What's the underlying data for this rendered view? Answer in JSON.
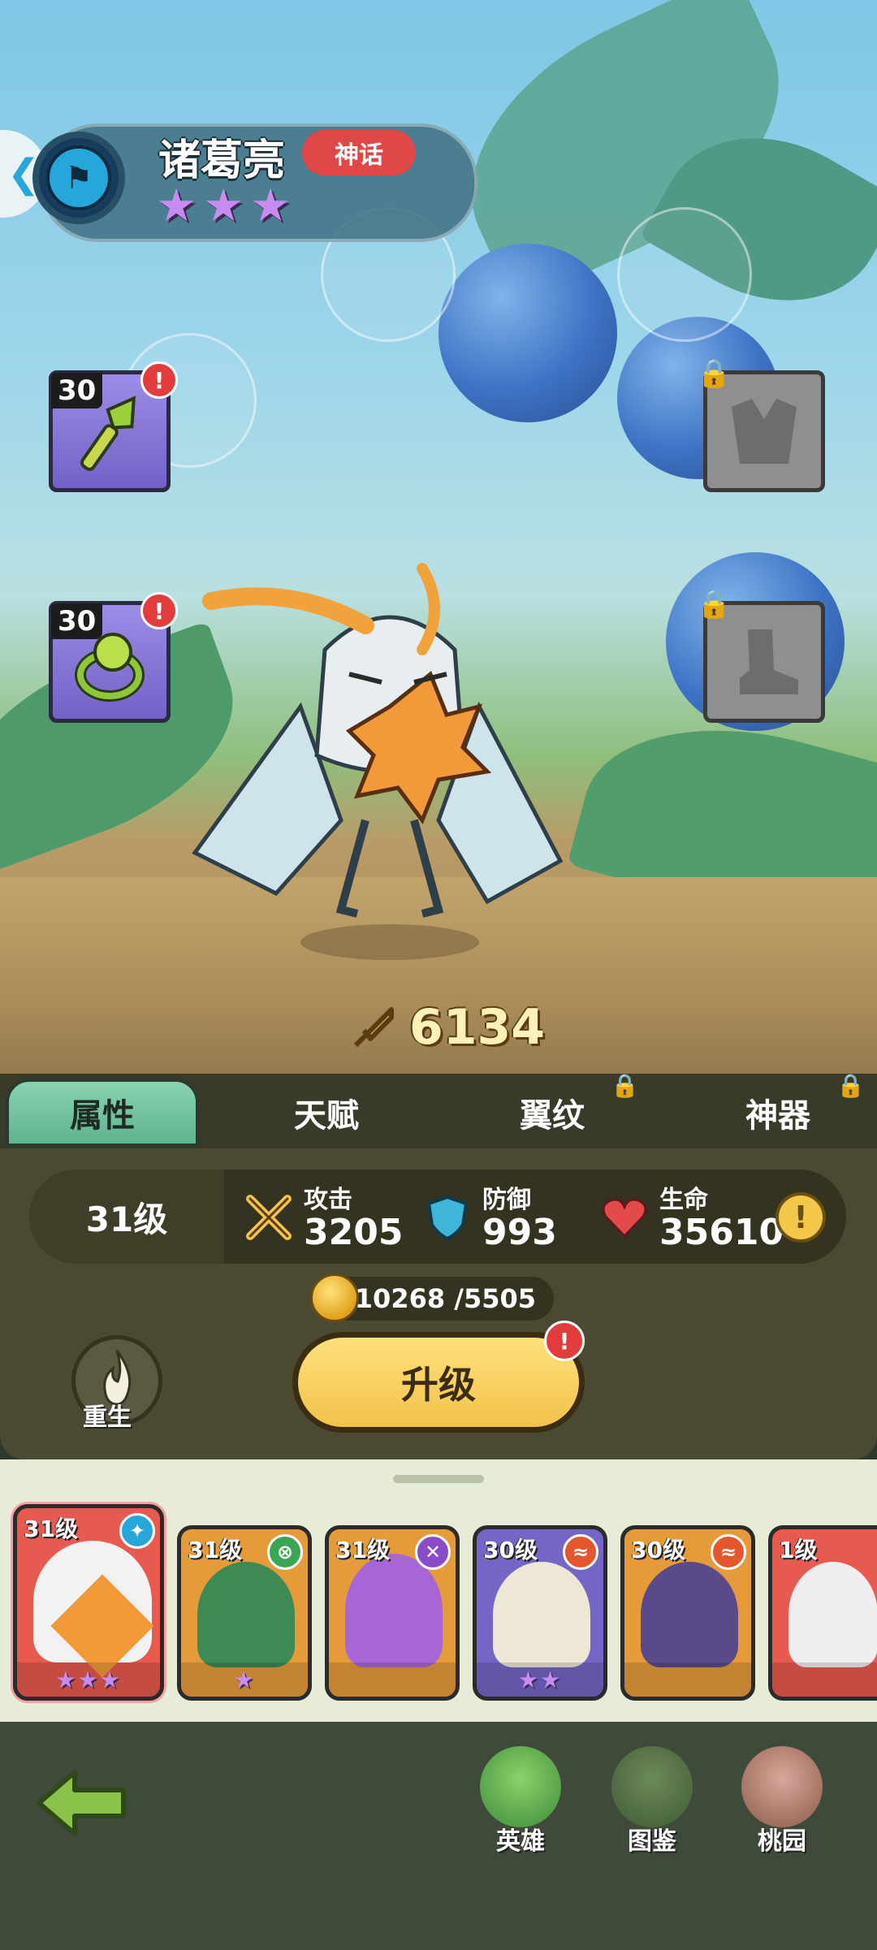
{
  "hero": {
    "name": "诸葛亮",
    "rarity": "神话",
    "stars": 3,
    "class_icon": "flag-glyph",
    "power": "6134"
  },
  "equipment": [
    {
      "slot": "weapon",
      "icon": "green-scepter-icon",
      "level": "30",
      "alert": "!",
      "locked": false
    },
    {
      "slot": "ring",
      "icon": "green-ring-icon",
      "level": "30",
      "alert": "!",
      "locked": false
    },
    {
      "slot": "armor",
      "icon": "armor-silhouette-icon",
      "level": "",
      "locked": true
    },
    {
      "slot": "boots",
      "icon": "boot-silhouette-icon",
      "level": "",
      "locked": true
    }
  ],
  "tabs": [
    {
      "label": "属性",
      "active": true,
      "locked": false
    },
    {
      "label": "天赋",
      "active": false,
      "locked": false
    },
    {
      "label": "翼纹",
      "active": false,
      "locked": true
    },
    {
      "label": "神器",
      "active": false,
      "locked": true
    }
  ],
  "stats": {
    "level": "31级",
    "attack_label": "攻击",
    "attack_value": "3205",
    "defense_label": "防御",
    "defense_value": "993",
    "hp_label": "生命",
    "hp_value": "35610"
  },
  "upgrade": {
    "cost": "10268 /5505",
    "button_label": "升级",
    "alert": "!"
  },
  "rebirth_label": "重生",
  "roster": [
    {
      "level": "31级",
      "badge": "✦",
      "badge_color": "#27a7d9",
      "stars": "★★★",
      "bg": "#e85a4f",
      "selected": true
    },
    {
      "level": "31级",
      "badge": "⊗",
      "badge_color": "#3aa655",
      "stars": "★",
      "bg": "#e59b3a",
      "selected": false
    },
    {
      "level": "31级",
      "badge": "✕",
      "badge_color": "#8a4bc9",
      "stars": "",
      "bg": "#e59b3a",
      "selected": false
    },
    {
      "level": "30级",
      "badge": "≈",
      "badge_color": "#e4572e",
      "stars": "★★",
      "bg": "#7466c7",
      "selected": false
    },
    {
      "level": "30级",
      "badge": "≈",
      "badge_color": "#e4572e",
      "stars": "",
      "bg": "#e59b3a",
      "selected": false
    },
    {
      "level": "1级",
      "badge": "",
      "badge_color": "#8a4bc9",
      "stars": "",
      "bg": "#e85a4f",
      "selected": false
    }
  ],
  "nav": {
    "back_icon": "green-back-arrow-icon",
    "items": [
      {
        "label": "英雄",
        "icon": "hero-frog-icon"
      },
      {
        "label": "图鉴",
        "icon": "puzzle-bag-icon"
      },
      {
        "label": "桃园",
        "icon": "peach-garden-icon"
      }
    ]
  },
  "colors": {
    "rarity_red": "#e04848",
    "star_purple": "#c78cf0",
    "active_tab_green": "#6cbf9a",
    "upgrade_yellow": "#f2c24a"
  }
}
